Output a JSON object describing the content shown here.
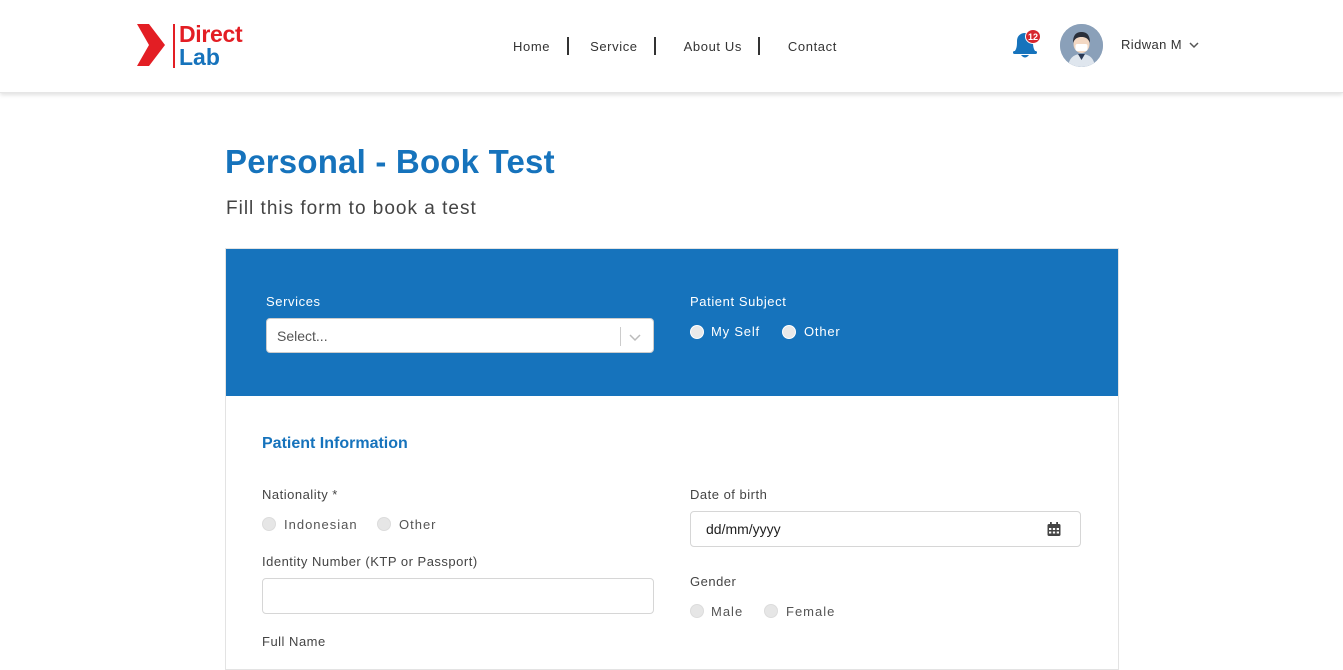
{
  "logo": {
    "line1": "Direct",
    "line2": "Lab"
  },
  "nav": {
    "home": "Home",
    "service": "Service",
    "about": "About Us",
    "contact": "Contact"
  },
  "user": {
    "notification_count": "12",
    "name": "Ridwan M"
  },
  "page": {
    "title": "Personal - Book Test",
    "subtitle": "Fill this form to book a test"
  },
  "services": {
    "label": "Services",
    "placeholder": "Select..."
  },
  "patient_subject": {
    "label": "Patient Subject",
    "options": [
      "My Self",
      "Other"
    ]
  },
  "patient_info": {
    "title": "Patient Information",
    "nationality_label": "Nationality *",
    "nationality_options": [
      "Indonesian",
      "Other"
    ],
    "identity_label": "Identity Number (KTP or Passport)",
    "identity_value": "",
    "fullname_label": "Full Name",
    "dob_label": "Date of birth",
    "dob_placeholder": "dd/mm/yyyy",
    "gender_label": "Gender",
    "gender_options": [
      "Male",
      "Female"
    ]
  },
  "colors": {
    "brand_blue": "#1673bc",
    "brand_red": "#e31e24",
    "badge_red": "#d6262d"
  },
  "icons": [
    "logo-chevron",
    "bell-icon",
    "avatar",
    "chevron-down-icon",
    "calendar-icon"
  ]
}
